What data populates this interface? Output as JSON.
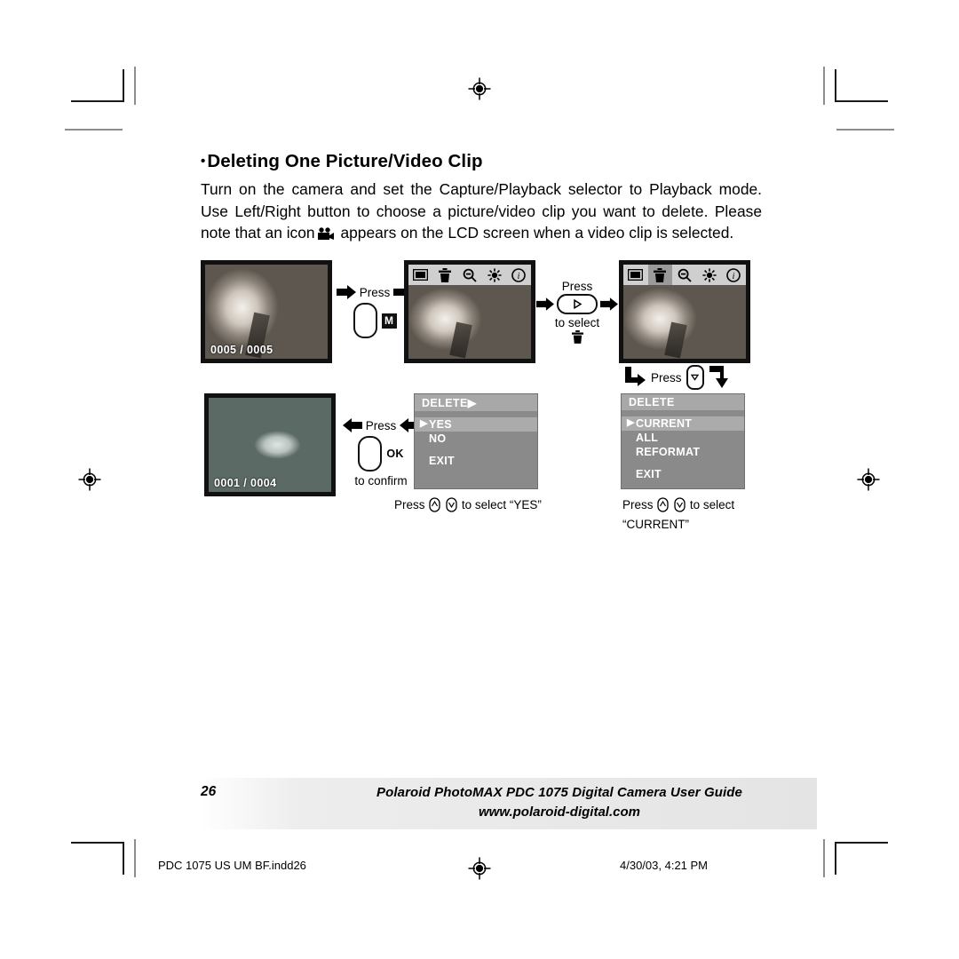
{
  "page": {
    "heading_bullet": "•",
    "heading": "Deleting One Picture/Video Clip",
    "body_part1": "Turn on the camera and set the Capture/Playback selector to Playback mode.  Use Left/Right button to choose a picture/video clip you want to delete.  Please note that an icon",
    "body_part2": "appears on the LCD screen when a video clip is selected.",
    "video_icon_name": "video-camera-icon"
  },
  "diagram": {
    "lcd1": {
      "counter": "0005 / 0005",
      "image_name": "two-kids-photo"
    },
    "lcd2": {
      "counter": "",
      "image_name": "two-kids-photo",
      "selected_icon": "frame-icon"
    },
    "lcd3": {
      "counter": "",
      "image_name": "two-kids-photo",
      "selected_icon": "trash-icon"
    },
    "lcd4": {
      "counter": "0001 / 0004",
      "image_name": "fish-reef-photo"
    },
    "toolbar_icons": [
      "frame-icon",
      "trash-icon",
      "zoom-out-icon",
      "brightness-icon",
      "info-icon"
    ],
    "step1": {
      "press": "Press",
      "button_label": "M"
    },
    "step2": {
      "press": "Press",
      "button_glyph": "▷",
      "to_select": "to select",
      "target_icon": "trash-icon"
    },
    "step3": {
      "press": "Press",
      "button_glyph": "▽"
    },
    "step4": {
      "press": "Press",
      "button_label": "OK",
      "to_confirm": "to confirm"
    },
    "menu_yes": {
      "title": "DELETE▶",
      "rows": [
        {
          "label": "YES",
          "highlighted": true,
          "marker": "▶"
        },
        {
          "label": "NO",
          "highlighted": false,
          "marker": ""
        },
        {
          "label": "EXIT",
          "highlighted": false,
          "marker": ""
        }
      ]
    },
    "menu_current": {
      "title": "DELETE",
      "rows": [
        {
          "label": "CURRENT",
          "highlighted": true,
          "marker": "▶"
        },
        {
          "label": "ALL",
          "highlighted": false,
          "marker": ""
        },
        {
          "label": "REFORMAT",
          "highlighted": false,
          "marker": ""
        },
        {
          "label": "EXIT",
          "highlighted": false,
          "marker": ""
        }
      ]
    },
    "caption_yes_pre": "Press",
    "caption_yes_post": "to select “YES”",
    "caption_current_pre": "Press",
    "caption_current_post": "to select",
    "caption_current_line2": "“CURRENT”"
  },
  "footer": {
    "page_number": "26",
    "title_line": "Polaroid PhotoMAX PDC 1075 Digital Camera User Guide",
    "url_line": "www.polaroid-digital.com",
    "production_file": "PDC 1075 US UM BF.indd26",
    "production_date": "4/30/03, 4:21 PM"
  },
  "marks": {
    "registration_icon": "registration-target-icon",
    "trim_icon": "crop-trim-mark"
  }
}
